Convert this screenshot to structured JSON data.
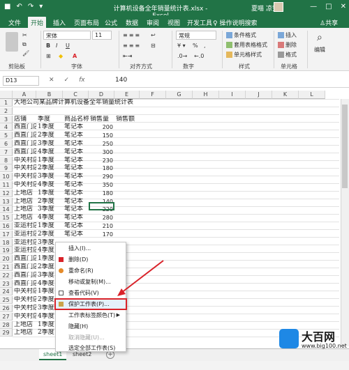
{
  "titlebar": {
    "title": "计算机设备全年销量统计表.xlsx - Excel",
    "user": "夏喵 凉安",
    "minimize": "—",
    "restore": "□",
    "close": "✕"
  },
  "tabs": [
    "文件",
    "开始",
    "插入",
    "页面布局",
    "公式",
    "数据",
    "审阅",
    "视图",
    "开发工具"
  ],
  "active_tab": "开始",
  "help_text": "操作说明搜索",
  "share_text": "共享",
  "ribbon": {
    "font_name": "宋体",
    "font_size": "11",
    "number_format": "常规",
    "groups": {
      "clipboard": "剪贴板",
      "font": "字体",
      "alignment": "对齐方式",
      "number": "数字",
      "styles": "样式",
      "cells": "单元格",
      "editing": "编辑"
    },
    "styles_items": [
      "条件格式",
      "套用表格格式",
      "单元格样式"
    ],
    "cells_items": [
      "插入",
      "删除",
      "格式"
    ],
    "bold": "B",
    "italic": "I",
    "underline": "U",
    "percent": "%",
    "fx": "fx"
  },
  "formula_bar": {
    "name_box": "D13",
    "value": "140"
  },
  "columns": [
    "A",
    "B",
    "C",
    "D",
    "E",
    "F",
    "G",
    "H",
    "I",
    "J",
    "K",
    "L"
  ],
  "rows": [
    "1",
    "2",
    "3",
    "4",
    "5",
    "6",
    "7",
    "8",
    "9",
    "10",
    "11",
    "12",
    "13",
    "14",
    "15",
    "16",
    "17",
    "18",
    "19",
    "20",
    "21",
    "22",
    "23",
    "24",
    "25",
    "26",
    "27",
    "28",
    "29"
  ],
  "sheet": {
    "title": "大地公司某品牌计算机设备全年销量统计表",
    "headers": [
      "店铺",
      "季度",
      "商品名称",
      "销售量",
      "销售额"
    ],
    "data": [
      [
        "西直门店",
        "1季度",
        "笔记本",
        "200"
      ],
      [
        "西直门店",
        "2季度",
        "笔记本",
        "150"
      ],
      [
        "西直门店",
        "3季度",
        "笔记本",
        "250"
      ],
      [
        "西直门店",
        "4季度",
        "笔记本",
        "300"
      ],
      [
        "中关村店",
        "1季度",
        "笔记本",
        "230"
      ],
      [
        "中关村店",
        "2季度",
        "笔记本",
        "180"
      ],
      [
        "中关村店",
        "3季度",
        "笔记本",
        "290"
      ],
      [
        "中关村店",
        "4季度",
        "笔记本",
        "350"
      ],
      [
        "上地店",
        "1季度",
        "笔记本",
        "180"
      ],
      [
        "上地店",
        "2季度",
        "笔记本",
        "140"
      ],
      [
        "上地店",
        "3季度",
        "笔记本",
        "220"
      ],
      [
        "上地店",
        "4季度",
        "笔记本",
        "280"
      ],
      [
        "亚运村店",
        "1季度",
        "笔记本",
        "210"
      ],
      [
        "亚运村店",
        "2季度",
        "笔记本",
        "170"
      ],
      [
        "亚运村店",
        "3季度",
        "",
        ""
      ],
      [
        "亚运村店",
        "4季度",
        "",
        ""
      ],
      [
        "西直门店",
        "1季度",
        "",
        ""
      ],
      [
        "西直门店",
        "2季度",
        "",
        ""
      ],
      [
        "西直门店",
        "3季度",
        "",
        ""
      ],
      [
        "西直门店",
        "4季度",
        "",
        ""
      ],
      [
        "中关村店",
        "1季度",
        "",
        ""
      ],
      [
        "中关村店",
        "2季度",
        "",
        ""
      ],
      [
        "中关村店",
        "3季度",
        "",
        ""
      ],
      [
        "中关村店",
        "4季度",
        "",
        ""
      ],
      [
        "上地店",
        "1季度",
        "",
        ""
      ],
      [
        "上地店",
        "2季度",
        "",
        ""
      ]
    ]
  },
  "context_menu": [
    {
      "label": "插入(I)...",
      "disabled": false
    },
    {
      "label": "删除(D)",
      "disabled": false
    },
    {
      "label": "重命名(R)",
      "disabled": false
    },
    {
      "label": "移动或复制(M)...",
      "disabled": false
    },
    {
      "label": "查看代码(V)",
      "disabled": false
    },
    {
      "label": "保护工作表(P)...",
      "disabled": false,
      "highlight": true
    },
    {
      "label": "工作表标签颜色(T)",
      "disabled": false,
      "submenu": true
    },
    {
      "label": "隐藏(H)",
      "disabled": false
    },
    {
      "label": "取消隐藏(U)...",
      "disabled": true
    },
    {
      "label": "选定全部工作表(S)",
      "disabled": false
    }
  ],
  "sheet_tabs": [
    "sheet1",
    "sheet2"
  ],
  "active_sheet": "sheet1",
  "add_sheet": "+",
  "watermark": {
    "name": "大百网",
    "url": "www.big100.net"
  },
  "colors": {
    "excel_green": "#217346",
    "highlight_red": "#d9232a"
  }
}
